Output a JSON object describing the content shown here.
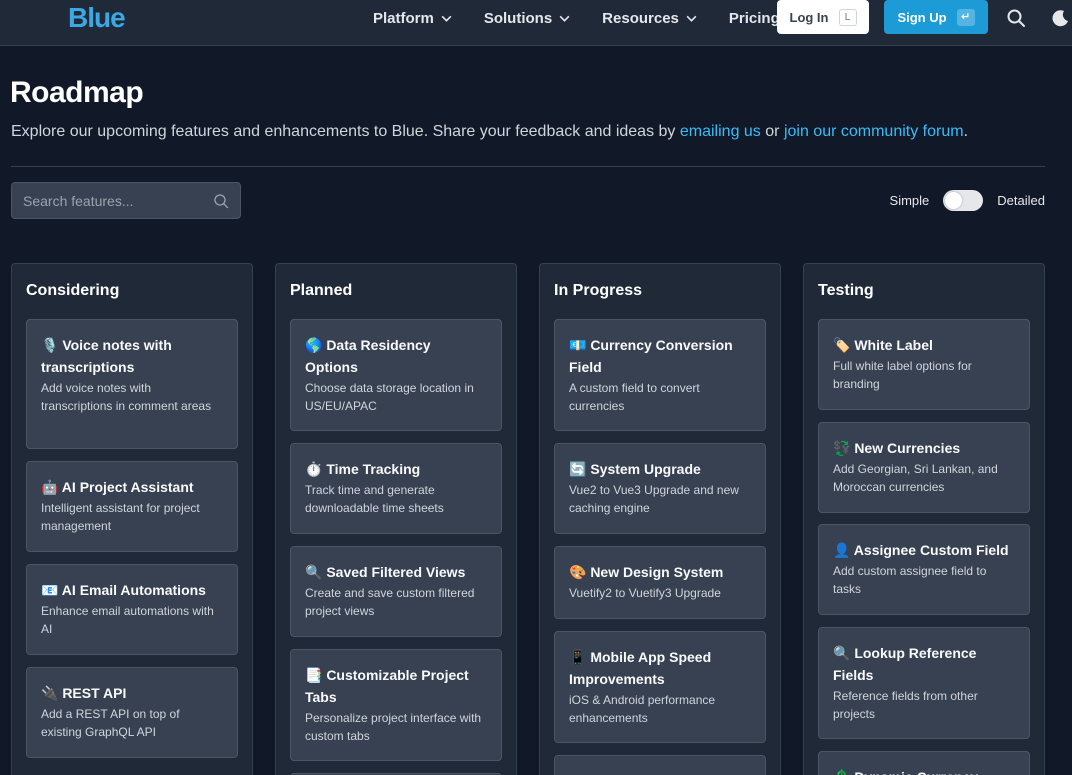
{
  "header": {
    "logo": "Blue",
    "nav": [
      {
        "label": "Platform",
        "has_dropdown": true
      },
      {
        "label": "Solutions",
        "has_dropdown": true
      },
      {
        "label": "Resources",
        "has_dropdown": true
      },
      {
        "label": "Pricing",
        "has_dropdown": false
      }
    ],
    "login_label": "Log In",
    "login_shortcut": "L",
    "signup_label": "Sign Up",
    "signup_shortcut": "↵"
  },
  "page": {
    "title": "Roadmap",
    "intro_prefix": "Explore our upcoming features and enhancements to Blue. Share your feedback and ideas by ",
    "intro_link1": "emailing us",
    "intro_mid": " or ",
    "intro_link2": "join our community forum",
    "intro_suffix": ".",
    "search_placeholder": "Search features...",
    "toggle_left": "Simple",
    "toggle_right": "Detailed"
  },
  "columns": [
    {
      "title": "Considering",
      "cards": [
        {
          "title": "🎙️ Voice notes with transcriptions",
          "desc": "Add voice notes with transcriptions in comment areas"
        },
        {
          "title": "🤖 AI Project Assistant",
          "desc": "Intelligent assistant for project management"
        },
        {
          "title": "📧 AI Email Automations",
          "desc": "Enhance email automations with AI"
        },
        {
          "title": "🔌 REST API",
          "desc": "Add a REST API on top of existing GraphQL API"
        }
      ]
    },
    {
      "title": "Planned",
      "cards": [
        {
          "title": "🌎 Data Residency Options",
          "desc": "Choose data storage location in US/EU/APAC"
        },
        {
          "title": "⏱️ Time Tracking",
          "desc": "Track time and generate downloadable time sheets"
        },
        {
          "title": "🔍 Saved Filtered Views",
          "desc": "Create and save custom filtered project views"
        },
        {
          "title": "📑 Customizable Project Tabs",
          "desc": "Personalize project interface with custom tabs"
        }
      ]
    },
    {
      "title": "In Progress",
      "cards": [
        {
          "title": "💶 Currency Conversion Field",
          "desc": "A custom field to convert currencies"
        },
        {
          "title": "🔄 System Upgrade",
          "desc": "Vue2 to Vue3 Upgrade and new caching engine"
        },
        {
          "title": "🎨 New Design System",
          "desc": "Vuetify2 to Vuetify3 Upgrade"
        },
        {
          "title": "📱 Mobile App Speed Improvements",
          "desc": "iOS & Android performance enhancements"
        }
      ]
    },
    {
      "title": "Testing",
      "cards": [
        {
          "title": "🏷️ White Label",
          "desc": "Full white label options for branding"
        },
        {
          "title": "💱 New Currencies",
          "desc": "Add Georgian, Sri Lankan, and Moroccan currencies"
        },
        {
          "title": "👤 Assignee Custom Field",
          "desc": "Add custom assignee field to tasks"
        },
        {
          "title": "🔍 Lookup Reference Fields",
          "desc": "Reference fields from other projects"
        },
        {
          "title": "💲 Dynamic Currency",
          "desc": ""
        }
      ]
    }
  ],
  "colors": {
    "background": "#111827",
    "accent": "#1d9bd7",
    "link": "#38bdf8",
    "card": "#374151"
  }
}
